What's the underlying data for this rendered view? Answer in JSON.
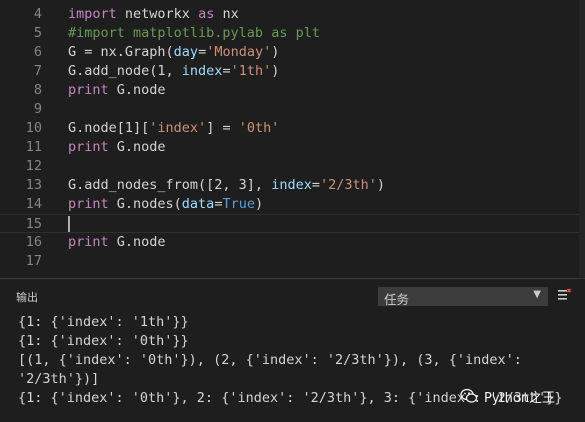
{
  "editor": {
    "lines": [
      {
        "num": "4",
        "tokens": [
          {
            "t": "import",
            "c": "kw"
          },
          {
            "t": " networkx ",
            "c": ""
          },
          {
            "t": "as",
            "c": "kw"
          },
          {
            "t": " nx",
            "c": ""
          }
        ]
      },
      {
        "num": "5",
        "tokens": [
          {
            "t": "#import matplotlib.pylab as plt",
            "c": "comment"
          }
        ]
      },
      {
        "num": "6",
        "tokens": [
          {
            "t": "G = nx.Graph(",
            "c": ""
          },
          {
            "t": "day",
            "c": "param"
          },
          {
            "t": "=",
            "c": ""
          },
          {
            "t": "'Monday'",
            "c": "str"
          },
          {
            "t": ")",
            "c": ""
          }
        ]
      },
      {
        "num": "7",
        "tokens": [
          {
            "t": "G.add_node(1, ",
            "c": ""
          },
          {
            "t": "index",
            "c": "param"
          },
          {
            "t": "=",
            "c": ""
          },
          {
            "t": "'1th'",
            "c": "str"
          },
          {
            "t": ")",
            "c": ""
          }
        ]
      },
      {
        "num": "8",
        "tokens": [
          {
            "t": "print",
            "c": "kw"
          },
          {
            "t": " G.node",
            "c": ""
          }
        ]
      },
      {
        "num": "9",
        "tokens": []
      },
      {
        "num": "10",
        "tokens": [
          {
            "t": "G.node[1][",
            "c": ""
          },
          {
            "t": "'index'",
            "c": "str"
          },
          {
            "t": "] = ",
            "c": ""
          },
          {
            "t": "'0th'",
            "c": "str"
          }
        ]
      },
      {
        "num": "11",
        "tokens": [
          {
            "t": "print",
            "c": "kw"
          },
          {
            "t": " G.node",
            "c": ""
          }
        ]
      },
      {
        "num": "12",
        "tokens": []
      },
      {
        "num": "13",
        "tokens": [
          {
            "t": "G.add_nodes_from([2, 3], ",
            "c": ""
          },
          {
            "t": "index",
            "c": "param"
          },
          {
            "t": "=",
            "c": ""
          },
          {
            "t": "'2/3th'",
            "c": "str"
          },
          {
            "t": ")",
            "c": ""
          }
        ]
      },
      {
        "num": "14",
        "tokens": [
          {
            "t": "print",
            "c": "kw"
          },
          {
            "t": " G.nodes(",
            "c": ""
          },
          {
            "t": "data",
            "c": "param"
          },
          {
            "t": "=",
            "c": ""
          },
          {
            "t": "True",
            "c": "bool"
          },
          {
            "t": ")",
            "c": ""
          }
        ]
      },
      {
        "num": "15",
        "tokens": [],
        "current": true
      },
      {
        "num": "16",
        "tokens": [
          {
            "t": "print",
            "c": "kw"
          },
          {
            "t": " G.node",
            "c": ""
          }
        ]
      },
      {
        "num": "17",
        "tokens": []
      }
    ]
  },
  "panel": {
    "title": "输出",
    "task_select": "任务",
    "clear_icon": "clear-output-icon"
  },
  "output": [
    "{1: {'index': '1th'}}",
    "{1: {'index': '0th'}}",
    "[(1, {'index': '0th'}), (2, {'index': '2/3th'}), (3, {'index':",
    "'2/3th'})]",
    "{1: {'index': '0th'}, 2: {'index': '2/3th'}, 3: {'index': '2/3th'}}"
  ],
  "watermark": {
    "text": "Python之王"
  },
  "colors": {
    "keyword": "#c586c0",
    "string": "#ce9178",
    "param": "#9cdcfe",
    "bool": "#569cd6",
    "comment": "#6a9955"
  }
}
